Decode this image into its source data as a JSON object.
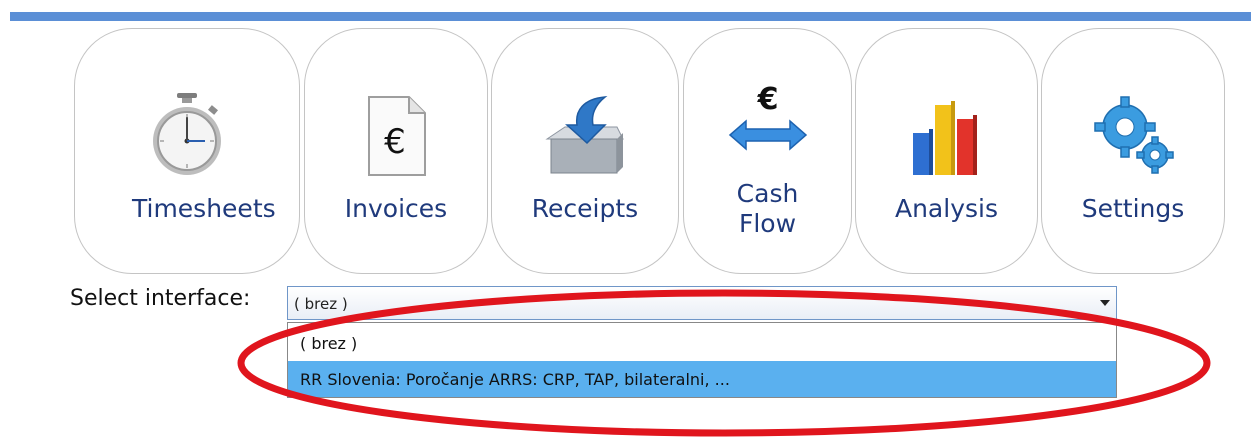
{
  "nav": {
    "items": [
      {
        "label": "Timesheets",
        "icon": "stopwatch-icon"
      },
      {
        "label": "Invoices",
        "icon": "invoice-document-icon",
        "glyph": "€"
      },
      {
        "label": "Receipts",
        "icon": "receipt-box-icon"
      },
      {
        "label": "Cash\nFlow",
        "icon": "cash-flow-icon",
        "glyph": "€"
      },
      {
        "label": "Analysis",
        "icon": "bar-chart-icon"
      },
      {
        "label": "Settings",
        "icon": "gears-icon"
      }
    ]
  },
  "interface": {
    "label": "Select interface:",
    "selected": "( brez )",
    "options": [
      "( brez )",
      "RR Slovenia: Poročanje ARRS: CRP, TAP, bilateralni, ..."
    ]
  },
  "colors": {
    "accent_bar": "#5b8fd6",
    "nav_text": "#1f3a7c",
    "highlight": "#5ab0ef",
    "annotation": "#e0151d"
  }
}
